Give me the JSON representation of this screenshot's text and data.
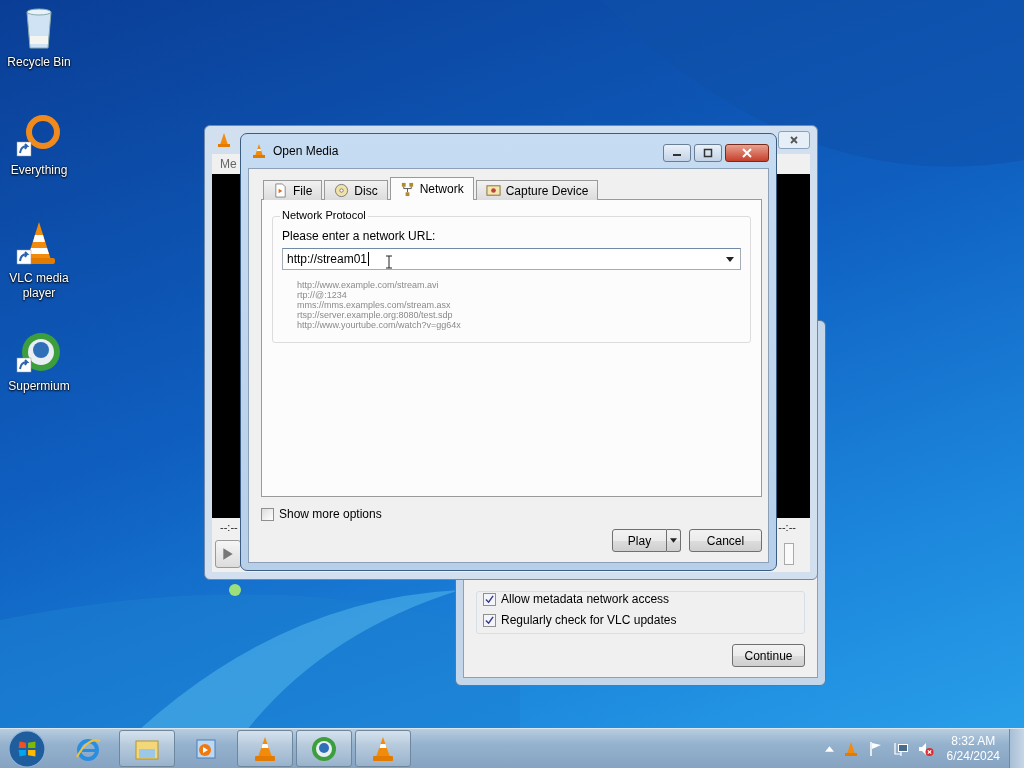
{
  "desktop_icons": [
    {
      "label": "Recycle Bin",
      "kind": "recycle",
      "shortcut": false
    },
    {
      "label": "Everything",
      "kind": "everything",
      "shortcut": true
    },
    {
      "label": "VLC media player",
      "kind": "vlc",
      "shortcut": true
    },
    {
      "label": "Supermium",
      "kind": "browser",
      "shortcut": true
    }
  ],
  "vlc_window": {
    "menu": "Me",
    "time_elapsed": "--:--",
    "time_total": "--:--"
  },
  "privacy_dialog": {
    "options": [
      {
        "label": "Allow metadata network access",
        "checked": true
      },
      {
        "label": "Regularly check for VLC updates",
        "checked": true
      }
    ],
    "button": "Continue"
  },
  "open_media": {
    "title": "Open Media",
    "tabs": [
      {
        "label": "File",
        "kind": "file",
        "selected": false
      },
      {
        "label": "Disc",
        "kind": "disc",
        "selected": false
      },
      {
        "label": "Network",
        "kind": "network",
        "selected": true
      },
      {
        "label": "Capture Device",
        "kind": "capture",
        "selected": false
      }
    ],
    "group_title": "Network Protocol",
    "url_label": "Please enter a network URL:",
    "url_value": "http://stream01",
    "examples": [
      "http://www.example.com/stream.avi",
      "rtp://@:1234",
      "mms://mms.examples.com/stream.asx",
      "rtsp://server.example.org:8080/test.sdp",
      "http://www.yourtube.com/watch?v=gg64x"
    ],
    "show_more_options": {
      "label": "Show more options",
      "checked": false
    },
    "play_button": "Play",
    "cancel_button": "Cancel"
  },
  "taskbar": {
    "items": [
      {
        "kind": "ie",
        "open": false
      },
      {
        "kind": "explorer",
        "open": true
      },
      {
        "kind": "media",
        "open": false
      },
      {
        "kind": "vlc",
        "open": true
      },
      {
        "kind": "browser",
        "open": true
      },
      {
        "kind": "vlc",
        "open": true
      }
    ],
    "time": "8:32 AM",
    "date": "6/24/2024"
  }
}
